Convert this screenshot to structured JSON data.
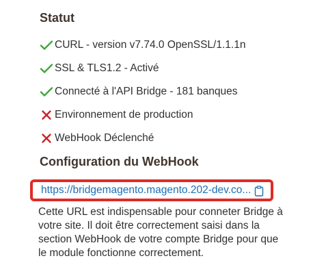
{
  "status": {
    "title": "Statut",
    "items": [
      {
        "state": "ok",
        "icon": "check-icon",
        "label": "CURL - version v7.74.0 OpenSSL/1.1.1n"
      },
      {
        "state": "ok",
        "icon": "check-icon",
        "label": "SSL & TLS1.2 - Activé"
      },
      {
        "state": "ok",
        "icon": "check-icon",
        "label": "Connecté à l'API Bridge - 181 banques"
      },
      {
        "state": "fail",
        "icon": "cross-icon",
        "label": "Environnement de production"
      },
      {
        "state": "fail",
        "icon": "cross-icon",
        "label": "WebHook Déclenché"
      }
    ]
  },
  "webhook": {
    "title": "Configuration du WebHook",
    "url": "https://bridgemagento.magento.202-dev.co...",
    "description": "Cette URL est indispensable pour conneter Bridge à votre site. Il doit être correctement saisi dans la section WebHook de votre compte Bridge pour que le module fonctionne correctement."
  },
  "colors": {
    "ok": "#3fa73a",
    "fail": "#c4242a",
    "link": "#1a6fb8",
    "highlight": "#e02b27"
  }
}
